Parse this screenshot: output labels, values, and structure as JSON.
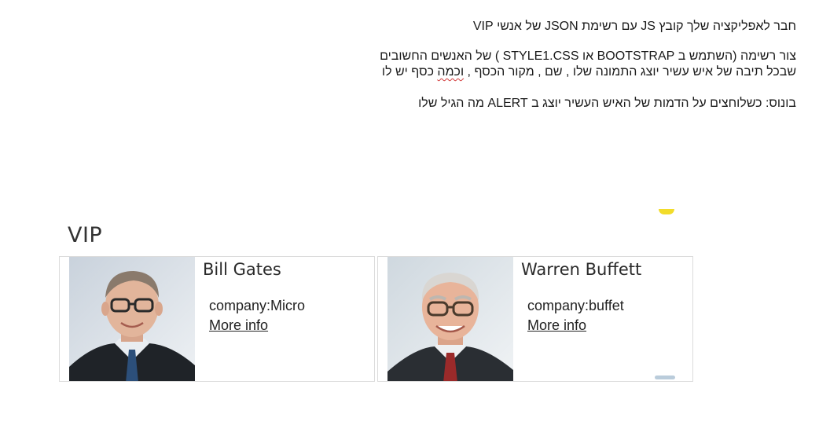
{
  "instructions": {
    "line1": "חבר לאפליקציה שלך קובץ JS עם רשימת JSON של אנשי VIP",
    "line2": "צור רשימה (השתמש ב BOOTSTRAP או STYLE1.CSS ) של האנשים החשובים",
    "line3_before": "שבכל תיבה של איש עשיר יוצג התמונה שלו , שם , מקור הכסף , ",
    "line3_flagged": "וכמה",
    "line3_after": " כסף יש לו",
    "line4": "בונוס: כשלוחצים על הדמות של האיש העשיר יוצג ב ALERT מה הגיל שלו"
  },
  "vip": {
    "title": "VIP",
    "people": [
      {
        "name": "Bill Gates",
        "company": "company:Micro",
        "more_info": "More info"
      },
      {
        "name": "Warren Buffett",
        "company": "company:buffet",
        "more_info": "More info"
      }
    ]
  },
  "colors": {
    "squiggle": "#d23a3a",
    "highlight": "#f2dc2a"
  }
}
